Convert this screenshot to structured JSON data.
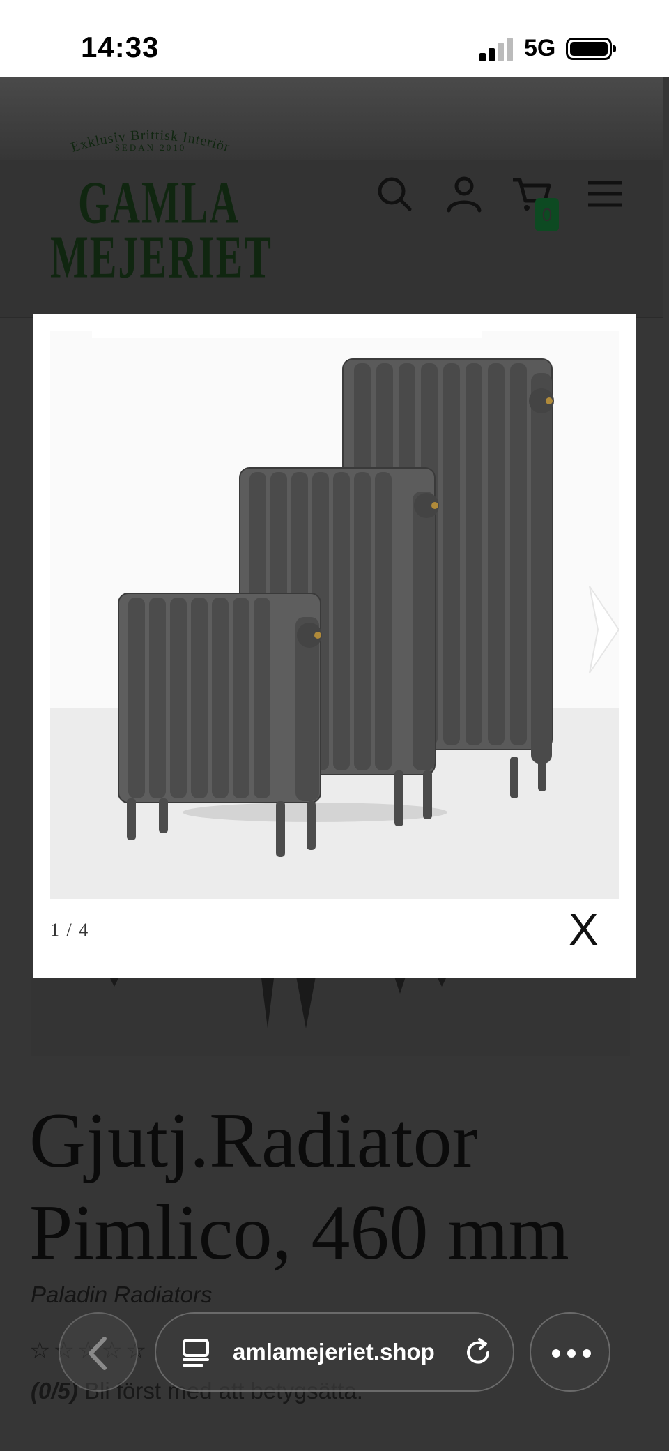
{
  "status_bar": {
    "time": "14:33",
    "network": "5G"
  },
  "header": {
    "logo_tagline": "Exklusiv Brittisk Interiör",
    "logo_since": "SEDAN 2010",
    "logo_line1": "GAMLA",
    "logo_line2": "MEJERIET",
    "cart_count": "0"
  },
  "lightbox": {
    "counter": "1 / 4",
    "close_label": "X"
  },
  "product": {
    "title": "Gjutj.Radiator Pimlico, 460 mm",
    "brand": "Paladin Radiators",
    "stars": "☆☆☆☆☆",
    "rating_count": "(0/5)",
    "rating_prompt": "Bli först med att betygsätta."
  },
  "browser": {
    "url": "amlamejeriet.shop"
  },
  "colors": {
    "cart_badge": "#0d4a22",
    "logo": "#102610"
  }
}
